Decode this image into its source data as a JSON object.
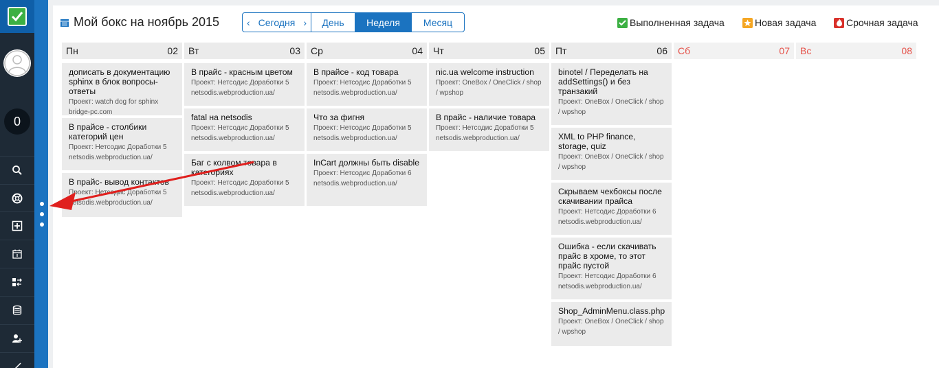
{
  "sidebar": {
    "counter": "0",
    "items": [
      {
        "icon": "search-icon"
      },
      {
        "icon": "lifebuoy-icon"
      },
      {
        "icon": "add-box-icon"
      },
      {
        "icon": "calendar-icon"
      },
      {
        "icon": "swap-icon"
      },
      {
        "icon": "database-icon"
      },
      {
        "icon": "add-user-icon"
      },
      {
        "icon": "pen-icon"
      }
    ]
  },
  "header": {
    "title": "Мой бокс на ноябрь 2015",
    "nav": {
      "prev": "‹",
      "today": "Сегодня",
      "next": "›",
      "day": "День",
      "week": "Неделя",
      "month": "Месяц",
      "active": "week"
    },
    "legend": {
      "done": "Выполненная задача",
      "new": "Новая задача",
      "urgent": "Срочная задача"
    }
  },
  "colors": {
    "accent": "#1b73c0",
    "done": "#3cb043",
    "new": "#f5a623",
    "urgent": "#d9312b",
    "weekend": "#e5534b",
    "annotation_arrow": "#e0201e"
  },
  "days": [
    {
      "name": "Пн",
      "num": "02",
      "tasks": [
        {
          "title": "дописать в документацию sphinx в блок вопросы-ответы",
          "proj1": "Проект: watch dog for sphinx",
          "proj2": "bridge-pc.com"
        },
        {
          "title": "В прайсе - столбики категорий цен",
          "proj1": "Проект: Нетсодис Доработки 5",
          "proj2": "netsodis.webproduction.ua/"
        },
        {
          "title": "В прайс- вывод контактов",
          "proj1": "Проект: Нетсодис Доработки 5",
          "proj2": "netsodis.webproduction.ua/"
        }
      ]
    },
    {
      "name": "Вт",
      "num": "03",
      "tasks": [
        {
          "title": "В прайс - красным цветом",
          "proj1": "Проект: Нетсодис Доработки 5",
          "proj2": "netsodis.webproduction.ua/"
        },
        {
          "title": "fatal на netsodis",
          "proj1": "Проект: Нетсодис Доработки 5",
          "proj2": "netsodis.webproduction.ua/"
        },
        {
          "title": "Баг с колвом товара в категориях",
          "proj1": "Проект: Нетсодис Доработки 5",
          "proj2": "netsodis.webproduction.ua/"
        }
      ]
    },
    {
      "name": "Ср",
      "num": "04",
      "tasks": [
        {
          "title": "В прайсе - код товара",
          "proj1": "Проект: Нетсодис Доработки 5",
          "proj2": "netsodis.webproduction.ua/"
        },
        {
          "title": "Что за фигня",
          "proj1": "Проект: Нетсодис Доработки 5",
          "proj2": "netsodis.webproduction.ua/"
        },
        {
          "title": "InCart должны быть disable",
          "proj1": "Проект: Нетсодис Доработки 6",
          "proj2": "netsodis.webproduction.ua/"
        }
      ]
    },
    {
      "name": "Чт",
      "num": "05",
      "tasks": [
        {
          "title": "nic.ua welcome instruction",
          "proj1": "Проект: OneBox / OneClick / shop",
          "proj2": "/ wpshop"
        },
        {
          "title": "В прайс - наличие товара",
          "proj1": "Проект: Нетсодис Доработки 5",
          "proj2": "netsodis.webproduction.ua/"
        }
      ]
    },
    {
      "name": "Пт",
      "num": "06",
      "tasks": [
        {
          "title": "binotel / Переделать на addSettings() и без транзакий",
          "proj1": "Проект: OneBox / OneClick / shop",
          "proj2": "/ wpshop"
        },
        {
          "title": "XML to PHP finance, storage, quiz",
          "proj1": "Проект: OneBox / OneClick / shop",
          "proj2": "/ wpshop"
        },
        {
          "title": "Скрываем чекбоксы после скачивании прайса",
          "proj1": "Проект: Нетсодис Доработки 6",
          "proj2": "netsodis.webproduction.ua/"
        },
        {
          "title": "Ошибка - если скачивать прайс в хроме, то этот прайс пустой",
          "proj1": "Проект: Нетсодис Доработки 6",
          "proj2": "netsodis.webproduction.ua/"
        },
        {
          "title": "Shop_AdminMenu.class.php",
          "proj1": "Проект: OneBox / OneClick / shop",
          "proj2": "/ wpshop"
        }
      ]
    },
    {
      "name": "Сб",
      "num": "07",
      "tasks": []
    },
    {
      "name": "Вс",
      "num": "08",
      "tasks": []
    }
  ]
}
